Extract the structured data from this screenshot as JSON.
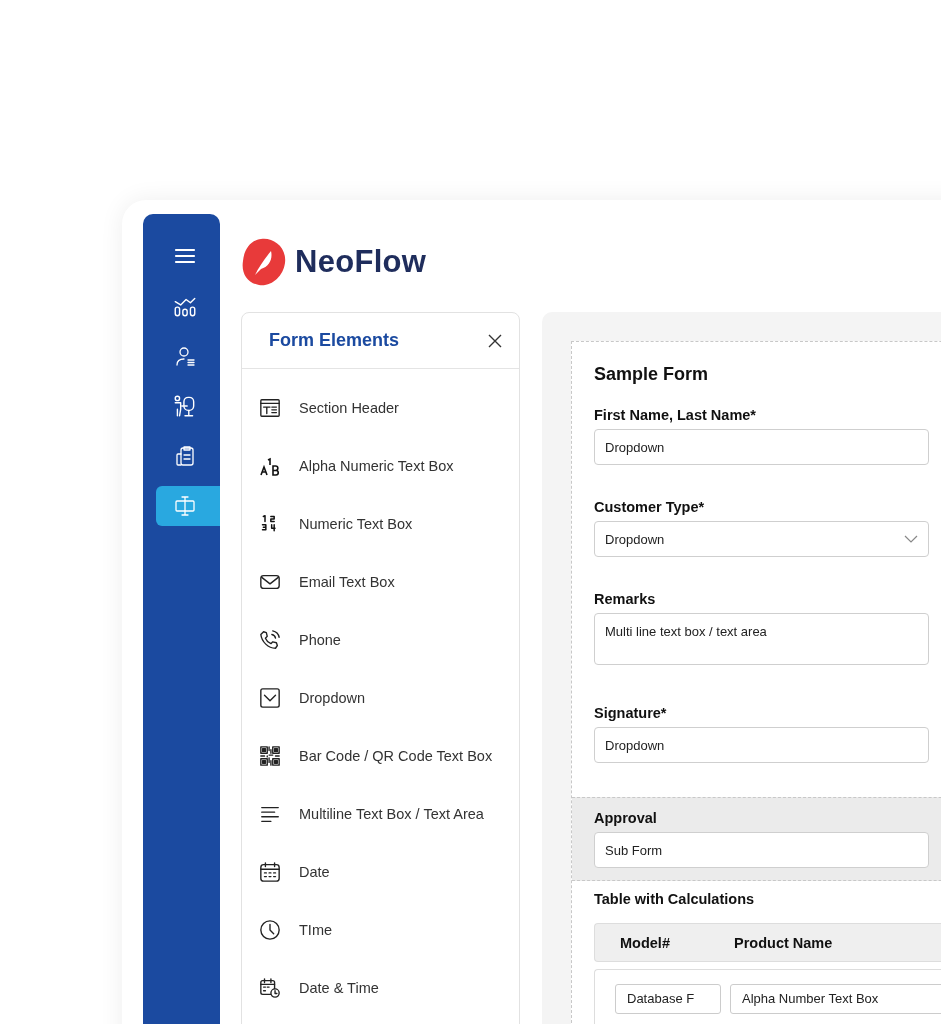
{
  "app": {
    "name": "NeoFlow"
  },
  "sidebar": {
    "items": [
      {
        "kind": "menu",
        "selected": false
      },
      {
        "kind": "chart",
        "selected": false
      },
      {
        "kind": "user",
        "selected": false
      },
      {
        "kind": "presenter",
        "selected": false
      },
      {
        "kind": "clipboard",
        "selected": false
      },
      {
        "kind": "form",
        "selected": true
      }
    ]
  },
  "form_elements": {
    "title": "Form Elements",
    "items": [
      {
        "kind": "section",
        "label": "Section Header"
      },
      {
        "kind": "alnum",
        "label": "Alpha Numeric Text Box"
      },
      {
        "kind": "numeric",
        "label": "Numeric Text Box"
      },
      {
        "kind": "email",
        "label": "Email Text Box"
      },
      {
        "kind": "phone",
        "label": "Phone"
      },
      {
        "kind": "dropdown",
        "label": "Dropdown"
      },
      {
        "kind": "qr",
        "label": "Bar Code / QR Code Text Box"
      },
      {
        "kind": "multiline",
        "label": "Multiline Text Box / Text Area"
      },
      {
        "kind": "date",
        "label": "Date"
      },
      {
        "kind": "time",
        "label": "TIme"
      },
      {
        "kind": "datetime",
        "label": "Date & Time"
      }
    ]
  },
  "form": {
    "title": "Sample Form",
    "fields": [
      {
        "kind": "text",
        "label": "First Name, Last Name*",
        "value": "Dropdown"
      },
      {
        "kind": "select",
        "label": "Customer Type*",
        "value": "Dropdown"
      },
      {
        "kind": "textarea",
        "label": "Remarks",
        "value": "Multi line text box / text area"
      },
      {
        "kind": "text",
        "label": "Signature*",
        "value": "Dropdown"
      }
    ],
    "subform": {
      "label": "Approval",
      "value": "Sub Form"
    },
    "table": {
      "title": "Table with Calculations",
      "columns": [
        "Model#",
        "Product Name"
      ],
      "rows": [
        [
          "Database F",
          "Alpha Number Text Box"
        ]
      ]
    }
  }
}
